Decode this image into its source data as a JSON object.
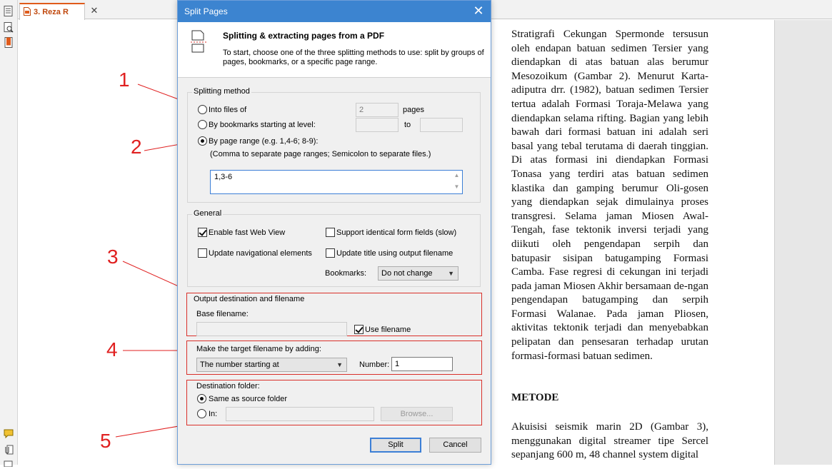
{
  "viewer": {
    "tab_label": "3. Reza R",
    "tab_close": "✕"
  },
  "dialog": {
    "title": "Split Pages",
    "close": "✕",
    "header_title": "Splitting & extracting pages from a PDF",
    "header_desc": "To start, choose one of the three splitting methods to use: split by groups of pages, bookmarks, or a specific page range.",
    "method": {
      "title": "Splitting method",
      "into_files_label": "Into files of",
      "into_files_value": "2",
      "pages_label": "pages",
      "bookmarks_label": "By bookmarks starting at level:",
      "to_label": "to",
      "page_range_label": "By page range (e.g. 1,4-6; 8-9):",
      "page_range_hint": "(Comma to separate page ranges; Semicolon to separate files.)",
      "page_range_value": "1,3-6"
    },
    "general": {
      "title": "General",
      "fast_web_view": "Enable fast Web View",
      "identical_fields": "Support identical form fields (slow)",
      "nav_elements": "Update navigational elements",
      "update_title": "Update title using output filename",
      "bookmarks_label": "Bookmarks:",
      "bookmarks_value": "Do not change"
    },
    "output": {
      "title": "Output destination and filename",
      "base_filename_label": "Base filename:",
      "base_filename_value": "",
      "use_filename": "Use filename"
    },
    "target": {
      "title": "Make the target filename by adding:",
      "mode_value": "The number starting at",
      "number_label": "Number:",
      "number_value": "1"
    },
    "dest": {
      "title": "Destination folder:",
      "same_as_source": "Same as source folder",
      "in_label": "In:",
      "in_value": "",
      "browse": "Browse..."
    },
    "split_button": "Split",
    "cancel_button": "Cancel"
  },
  "annotations": [
    "1",
    "2",
    "3",
    "4",
    "5"
  ],
  "document": {
    "paragraph1": "Stratigrafi Cekungan Spermonde tersusun oleh endapan batuan sedimen Tersier yang diendapkan di atas batuan alas berumur Mesozoikum (Gambar 2). Menurut Karta-adiputra drr. (1982), batuan sedimen Tersier tertua adalah Formasi Toraja-Melawa yang diendapkan selama rifting. Bagian yang lebih bawah dari formasi batuan ini adalah seri basal yang tebal terutama di daerah tinggian. Di atas formasi ini diendapkan Formasi Tonasa yang terdiri atas batuan sedimen klastika dan gamping berumur Oli-gosen yang diendapkan sejak dimulainya proses transgresi. Selama jaman Miosen Awal-Tengah, fase tektonik inversi terjadi yang diikuti oleh pengendapan serpih dan batupasir sisipan batugamping Formasi Camba. Fase regresi di cekungan ini terjadi pada jaman Miosen Akhir bersamaan de-ngan pengendapan batugamping dan serpih Formasi Walanae. Pada jaman Pliosen, aktivitas tektonik terjadi dan menyebabkan pelipatan dan pensesaran terhadap urutan formasi-formasi batuan sedimen.",
    "heading": "METODE",
    "paragraph2": "Akuisisi seismik marin 2D (Gambar 3), menggunakan digital streamer tipe Sercel sepanjang 600 m, 48 channel system digital"
  }
}
